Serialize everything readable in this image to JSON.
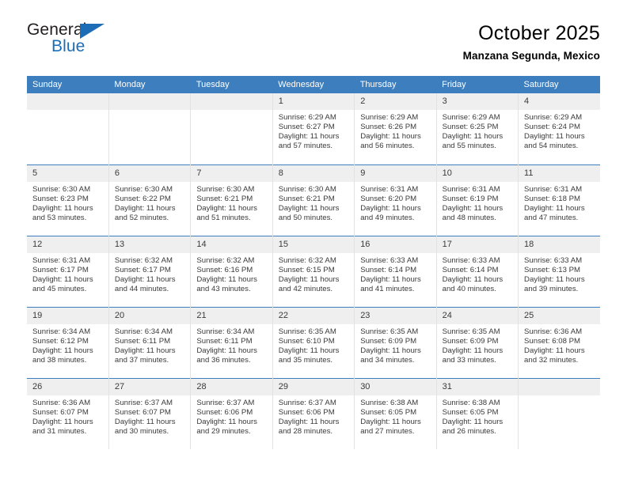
{
  "brand": {
    "name_top": "General",
    "name_bottom": "Blue",
    "triangle_color": "#1c6db5",
    "text_color": "#231f20"
  },
  "header": {
    "title": "October 2025",
    "subtitle": "Manzana Segunda, Mexico"
  },
  "theme": {
    "header_bg": "#3d7ebf",
    "header_text": "#ffffff",
    "daynum_bg": "#efefef",
    "cell_bg": "#ffffff",
    "grid_line": "#e2e2e2",
    "week_line": "#3d7ebf",
    "body_text": "#3a3a3a"
  },
  "weekday_headers": [
    "Sunday",
    "Monday",
    "Tuesday",
    "Wednesday",
    "Thursday",
    "Friday",
    "Saturday"
  ],
  "labels": {
    "sunrise_prefix": "Sunrise:",
    "sunset_prefix": "Sunset:",
    "daylight_prefix": "Daylight:"
  },
  "weeks": [
    [
      {
        "day": "",
        "blank": true,
        "sunrise": "",
        "sunset": "",
        "daylight_line1": "",
        "daylight_line2": ""
      },
      {
        "day": "",
        "blank": true,
        "sunrise": "",
        "sunset": "",
        "daylight_line1": "",
        "daylight_line2": ""
      },
      {
        "day": "",
        "blank": true,
        "sunrise": "",
        "sunset": "",
        "daylight_line1": "",
        "daylight_line2": ""
      },
      {
        "day": "1",
        "sunrise": "Sunrise: 6:29 AM",
        "sunset": "Sunset: 6:27 PM",
        "daylight_line1": "Daylight: 11 hours",
        "daylight_line2": "and 57 minutes."
      },
      {
        "day": "2",
        "sunrise": "Sunrise: 6:29 AM",
        "sunset": "Sunset: 6:26 PM",
        "daylight_line1": "Daylight: 11 hours",
        "daylight_line2": "and 56 minutes."
      },
      {
        "day": "3",
        "sunrise": "Sunrise: 6:29 AM",
        "sunset": "Sunset: 6:25 PM",
        "daylight_line1": "Daylight: 11 hours",
        "daylight_line2": "and 55 minutes."
      },
      {
        "day": "4",
        "sunrise": "Sunrise: 6:29 AM",
        "sunset": "Sunset: 6:24 PM",
        "daylight_line1": "Daylight: 11 hours",
        "daylight_line2": "and 54 minutes."
      }
    ],
    [
      {
        "day": "5",
        "sunrise": "Sunrise: 6:30 AM",
        "sunset": "Sunset: 6:23 PM",
        "daylight_line1": "Daylight: 11 hours",
        "daylight_line2": "and 53 minutes."
      },
      {
        "day": "6",
        "sunrise": "Sunrise: 6:30 AM",
        "sunset": "Sunset: 6:22 PM",
        "daylight_line1": "Daylight: 11 hours",
        "daylight_line2": "and 52 minutes."
      },
      {
        "day": "7",
        "sunrise": "Sunrise: 6:30 AM",
        "sunset": "Sunset: 6:21 PM",
        "daylight_line1": "Daylight: 11 hours",
        "daylight_line2": "and 51 minutes."
      },
      {
        "day": "8",
        "sunrise": "Sunrise: 6:30 AM",
        "sunset": "Sunset: 6:21 PM",
        "daylight_line1": "Daylight: 11 hours",
        "daylight_line2": "and 50 minutes."
      },
      {
        "day": "9",
        "sunrise": "Sunrise: 6:31 AM",
        "sunset": "Sunset: 6:20 PM",
        "daylight_line1": "Daylight: 11 hours",
        "daylight_line2": "and 49 minutes."
      },
      {
        "day": "10",
        "sunrise": "Sunrise: 6:31 AM",
        "sunset": "Sunset: 6:19 PM",
        "daylight_line1": "Daylight: 11 hours",
        "daylight_line2": "and 48 minutes."
      },
      {
        "day": "11",
        "sunrise": "Sunrise: 6:31 AM",
        "sunset": "Sunset: 6:18 PM",
        "daylight_line1": "Daylight: 11 hours",
        "daylight_line2": "and 47 minutes."
      }
    ],
    [
      {
        "day": "12",
        "sunrise": "Sunrise: 6:31 AM",
        "sunset": "Sunset: 6:17 PM",
        "daylight_line1": "Daylight: 11 hours",
        "daylight_line2": "and 45 minutes."
      },
      {
        "day": "13",
        "sunrise": "Sunrise: 6:32 AM",
        "sunset": "Sunset: 6:17 PM",
        "daylight_line1": "Daylight: 11 hours",
        "daylight_line2": "and 44 minutes."
      },
      {
        "day": "14",
        "sunrise": "Sunrise: 6:32 AM",
        "sunset": "Sunset: 6:16 PM",
        "daylight_line1": "Daylight: 11 hours",
        "daylight_line2": "and 43 minutes."
      },
      {
        "day": "15",
        "sunrise": "Sunrise: 6:32 AM",
        "sunset": "Sunset: 6:15 PM",
        "daylight_line1": "Daylight: 11 hours",
        "daylight_line2": "and 42 minutes."
      },
      {
        "day": "16",
        "sunrise": "Sunrise: 6:33 AM",
        "sunset": "Sunset: 6:14 PM",
        "daylight_line1": "Daylight: 11 hours",
        "daylight_line2": "and 41 minutes."
      },
      {
        "day": "17",
        "sunrise": "Sunrise: 6:33 AM",
        "sunset": "Sunset: 6:14 PM",
        "daylight_line1": "Daylight: 11 hours",
        "daylight_line2": "and 40 minutes."
      },
      {
        "day": "18",
        "sunrise": "Sunrise: 6:33 AM",
        "sunset": "Sunset: 6:13 PM",
        "daylight_line1": "Daylight: 11 hours",
        "daylight_line2": "and 39 minutes."
      }
    ],
    [
      {
        "day": "19",
        "sunrise": "Sunrise: 6:34 AM",
        "sunset": "Sunset: 6:12 PM",
        "daylight_line1": "Daylight: 11 hours",
        "daylight_line2": "and 38 minutes."
      },
      {
        "day": "20",
        "sunrise": "Sunrise: 6:34 AM",
        "sunset": "Sunset: 6:11 PM",
        "daylight_line1": "Daylight: 11 hours",
        "daylight_line2": "and 37 minutes."
      },
      {
        "day": "21",
        "sunrise": "Sunrise: 6:34 AM",
        "sunset": "Sunset: 6:11 PM",
        "daylight_line1": "Daylight: 11 hours",
        "daylight_line2": "and 36 minutes."
      },
      {
        "day": "22",
        "sunrise": "Sunrise: 6:35 AM",
        "sunset": "Sunset: 6:10 PM",
        "daylight_line1": "Daylight: 11 hours",
        "daylight_line2": "and 35 minutes."
      },
      {
        "day": "23",
        "sunrise": "Sunrise: 6:35 AM",
        "sunset": "Sunset: 6:09 PM",
        "daylight_line1": "Daylight: 11 hours",
        "daylight_line2": "and 34 minutes."
      },
      {
        "day": "24",
        "sunrise": "Sunrise: 6:35 AM",
        "sunset": "Sunset: 6:09 PM",
        "daylight_line1": "Daylight: 11 hours",
        "daylight_line2": "and 33 minutes."
      },
      {
        "day": "25",
        "sunrise": "Sunrise: 6:36 AM",
        "sunset": "Sunset: 6:08 PM",
        "daylight_line1": "Daylight: 11 hours",
        "daylight_line2": "and 32 minutes."
      }
    ],
    [
      {
        "day": "26",
        "sunrise": "Sunrise: 6:36 AM",
        "sunset": "Sunset: 6:07 PM",
        "daylight_line1": "Daylight: 11 hours",
        "daylight_line2": "and 31 minutes."
      },
      {
        "day": "27",
        "sunrise": "Sunrise: 6:37 AM",
        "sunset": "Sunset: 6:07 PM",
        "daylight_line1": "Daylight: 11 hours",
        "daylight_line2": "and 30 minutes."
      },
      {
        "day": "28",
        "sunrise": "Sunrise: 6:37 AM",
        "sunset": "Sunset: 6:06 PM",
        "daylight_line1": "Daylight: 11 hours",
        "daylight_line2": "and 29 minutes."
      },
      {
        "day": "29",
        "sunrise": "Sunrise: 6:37 AM",
        "sunset": "Sunset: 6:06 PM",
        "daylight_line1": "Daylight: 11 hours",
        "daylight_line2": "and 28 minutes."
      },
      {
        "day": "30",
        "sunrise": "Sunrise: 6:38 AM",
        "sunset": "Sunset: 6:05 PM",
        "daylight_line1": "Daylight: 11 hours",
        "daylight_line2": "and 27 minutes."
      },
      {
        "day": "31",
        "sunrise": "Sunrise: 6:38 AM",
        "sunset": "Sunset: 6:05 PM",
        "daylight_line1": "Daylight: 11 hours",
        "daylight_line2": "and 26 minutes."
      },
      {
        "day": "",
        "blank": true,
        "sunrise": "",
        "sunset": "",
        "daylight_line1": "",
        "daylight_line2": ""
      }
    ]
  ]
}
